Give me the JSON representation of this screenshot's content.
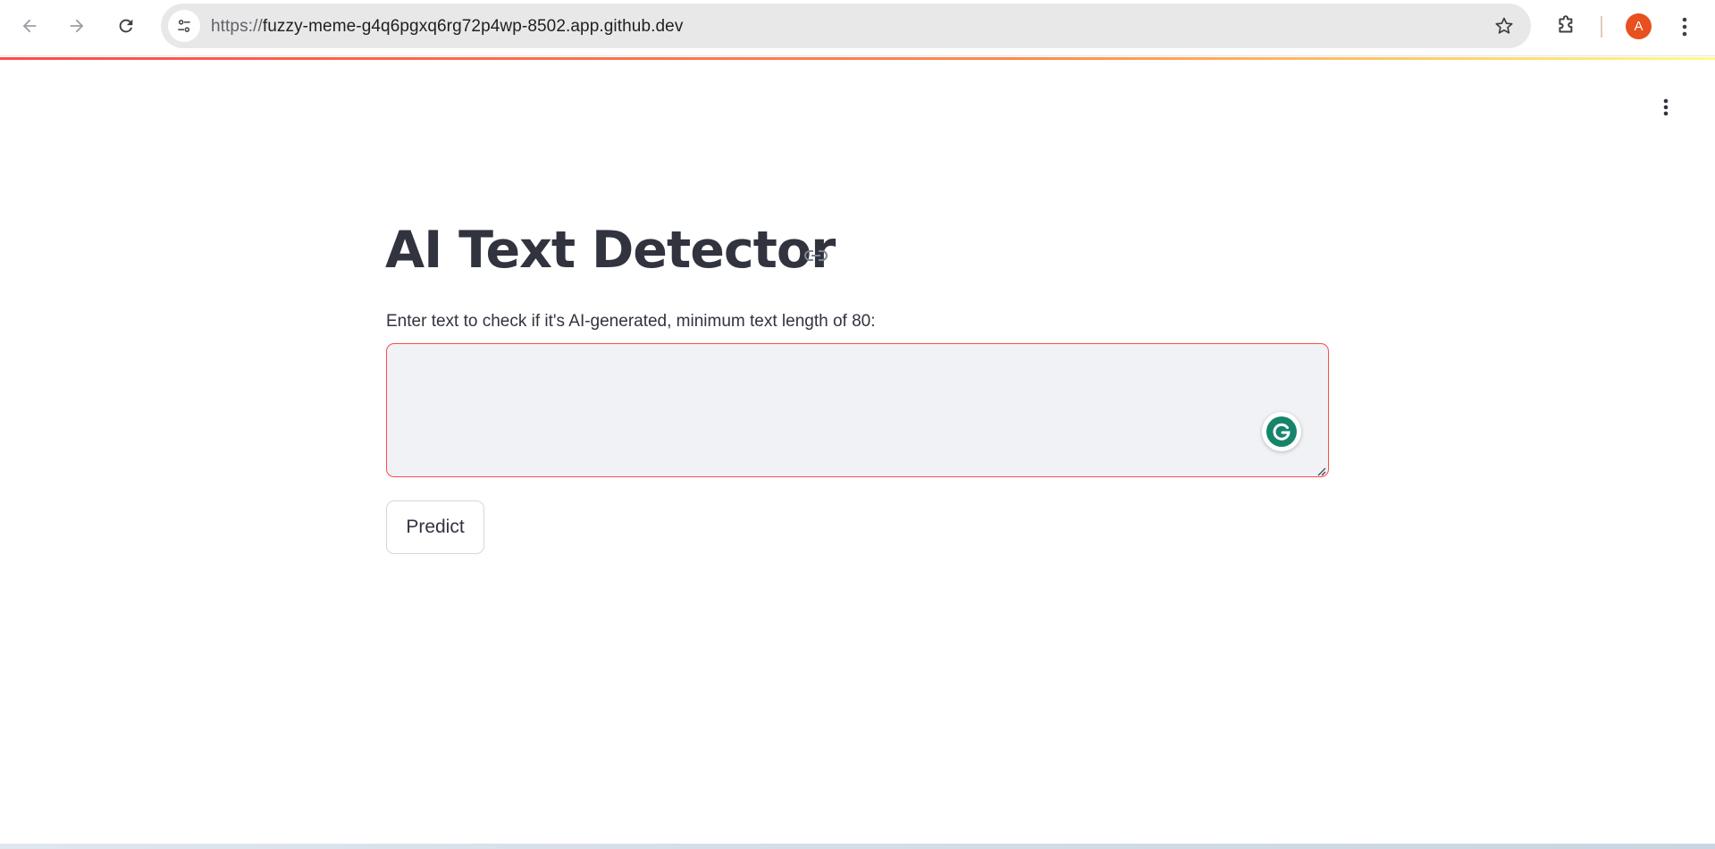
{
  "browser": {
    "url_scheme": "https://",
    "url_host": "fuzzy-meme-g4q6pgxq6rg72p4wp-8502.app.github.dev",
    "profile_initial": "A",
    "profile_color": "#e8501f"
  },
  "app": {
    "title": "AI Text Detector",
    "input_label": "Enter text to check if it's AI-generated, minimum text length of 80:",
    "input_value": "",
    "predict_button": "Predict",
    "accent_color": "#ff4b4b",
    "text_color": "#31333f"
  },
  "icons": {
    "back": "arrow-left-icon",
    "forward": "arrow-right-icon",
    "reload": "reload-icon",
    "site_info": "tune-icon",
    "bookmark": "star-icon",
    "extensions": "puzzle-icon",
    "chrome_menu": "kebab-icon",
    "app_menu": "kebab-icon",
    "anchor": "link-icon",
    "grammarly": "grammarly-icon"
  }
}
